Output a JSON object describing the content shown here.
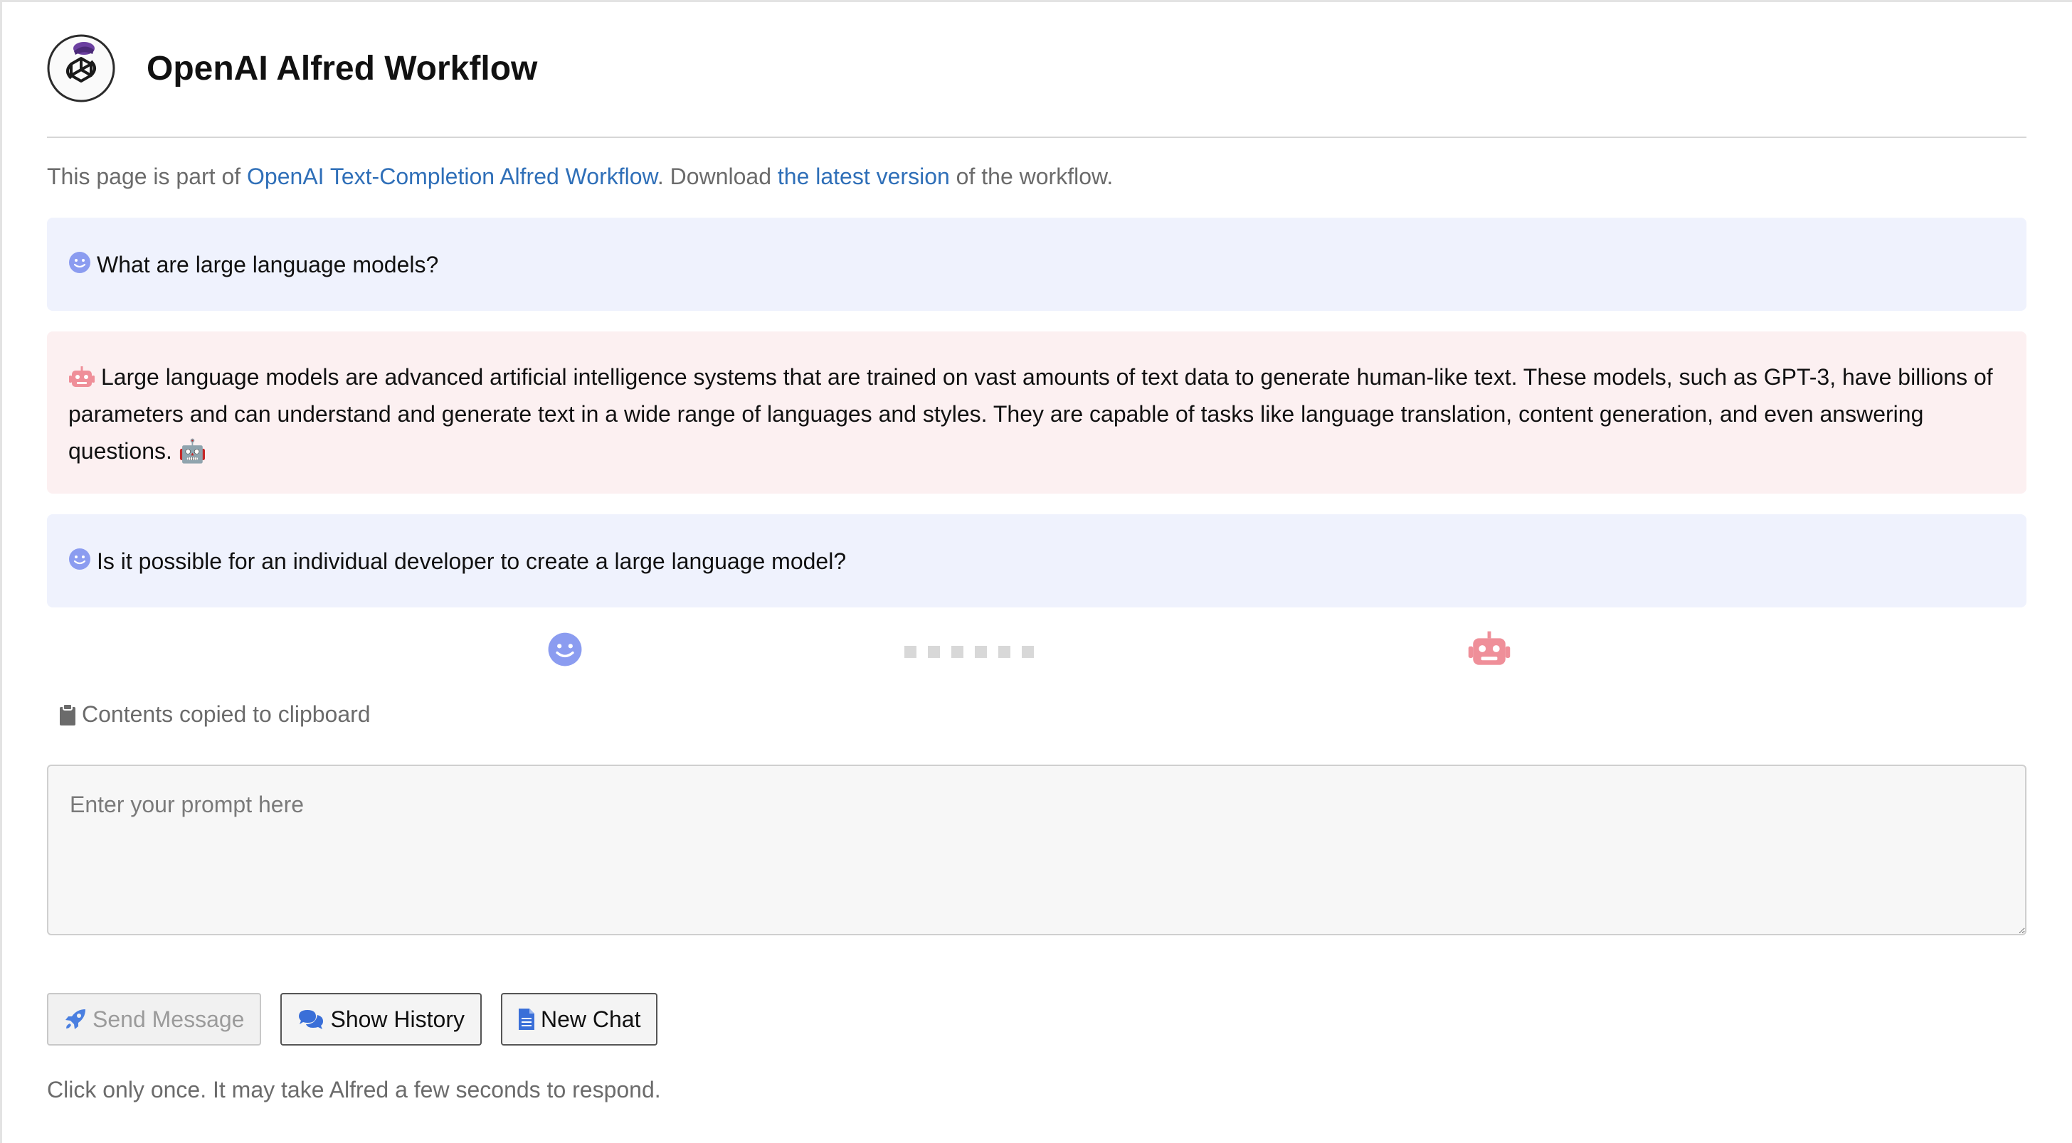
{
  "app": {
    "title": "OpenAI Alfred Workflow",
    "logo_icon": "openai-alfred-logo"
  },
  "intro": {
    "prefix": "This page is part of ",
    "link1": "OpenAI Text-Completion Alfred Workflow",
    "middle": ". Download ",
    "link2": "the latest version",
    "suffix": " of the workflow."
  },
  "colors": {
    "user_bg": "#eff2fd",
    "bot_bg": "#fcf0f1",
    "user_icon": "#8b9cf0",
    "bot_icon": "#ef8f99",
    "link": "#2f6fb8"
  },
  "conversation": [
    {
      "role": "user",
      "icon": "smile-icon",
      "text": "What are large language models?"
    },
    {
      "role": "assistant",
      "icon": "robot-icon",
      "text": "Large language models are advanced artificial intelligence systems that are trained on vast amounts of text data to generate human-like text. These models, such as GPT-3, have billions of parameters and can understand and generate text in a wide range of languages and styles. They are capable of tasks like language translation, content generation, and even answering questions.",
      "trailing_emoji": "🤖"
    },
    {
      "role": "user",
      "icon": "smile-icon",
      "text": "Is it possible for an individual developer to create a large language model?"
    }
  ],
  "status": {
    "clipboard_icon": "clipboard-icon",
    "clipboard_text": "Contents copied to clipboard"
  },
  "prompt": {
    "placeholder": "Enter your prompt here",
    "value": ""
  },
  "buttons": {
    "send": "Send Message",
    "history": "Show History",
    "new_chat": "New Chat"
  },
  "footer_note": "Click only once. It may take Alfred a few seconds to respond."
}
